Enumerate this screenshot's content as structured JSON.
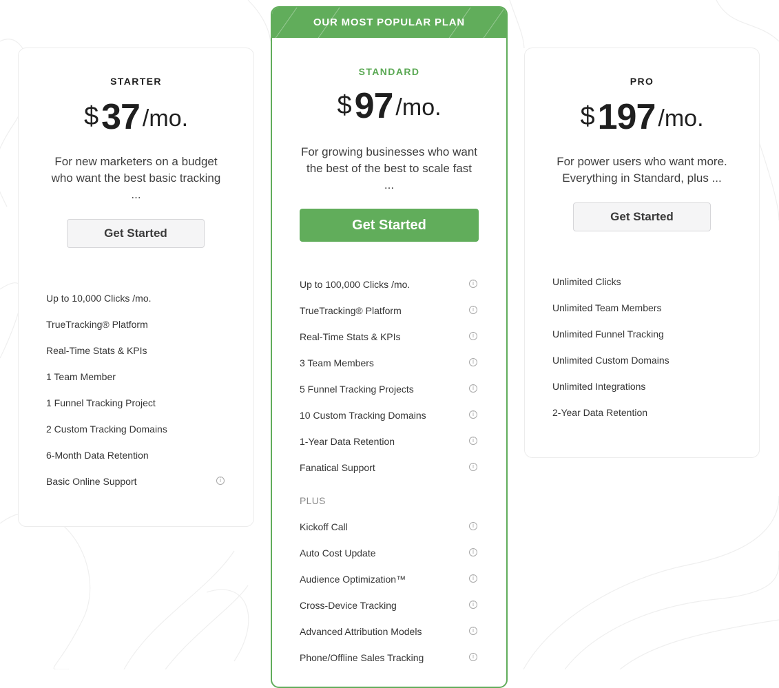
{
  "colors": {
    "accent": "#61ad5b",
    "border": "#ececec",
    "text": "#2b2b2b"
  },
  "starter": {
    "name": "STARTER",
    "currency": "$",
    "amount": "37",
    "period": "/mo.",
    "description": [
      "For new marketers on a budget",
      "who want the best basic tracking",
      "..."
    ],
    "cta": "Get Started",
    "features": [
      "Up to 10,000 Clicks /mo.",
      "TrueTracking® Platform",
      "Real-Time Stats & KPIs",
      "1 Team Member",
      "1 Funnel Tracking Project",
      "2 Custom Tracking Domains",
      "6-Month Data Retention",
      "Basic Online Support"
    ]
  },
  "standard": {
    "banner": "OUR MOST POPULAR PLAN",
    "name": "STANDARD",
    "currency": "$",
    "amount": "97",
    "period": "/mo.",
    "description": [
      "For growing businesses who want",
      "the best of the best to scale fast",
      "..."
    ],
    "cta": "Get Started",
    "features": [
      "Up to 100,000 Clicks /mo.",
      "TrueTracking® Platform",
      "Real-Time Stats & KPIs",
      "3 Team Members",
      "5 Funnel Tracking Projects",
      "10 Custom Tracking Domains",
      "1-Year Data Retention",
      "Fanatical Support"
    ],
    "plus_label": "PLUS",
    "plus_features": [
      "Kickoff Call",
      "Auto Cost Update",
      "Audience Optimization™",
      "Cross-Device Tracking",
      "Advanced Attribution Models",
      "Phone/Offline Sales Tracking"
    ]
  },
  "pro": {
    "name": "PRO",
    "currency": "$",
    "amount": "197",
    "period": "/mo.",
    "description": [
      "For power users who want more.",
      "Everything in Standard, plus ..."
    ],
    "cta": "Get Started",
    "features": [
      "Unlimited Clicks",
      "Unlimited Team Members",
      "Unlimited Funnel Tracking",
      "Unlimited Custom Domains",
      "Unlimited Integrations",
      "2-Year Data Retention"
    ]
  },
  "icons": {
    "info": "info-icon"
  }
}
